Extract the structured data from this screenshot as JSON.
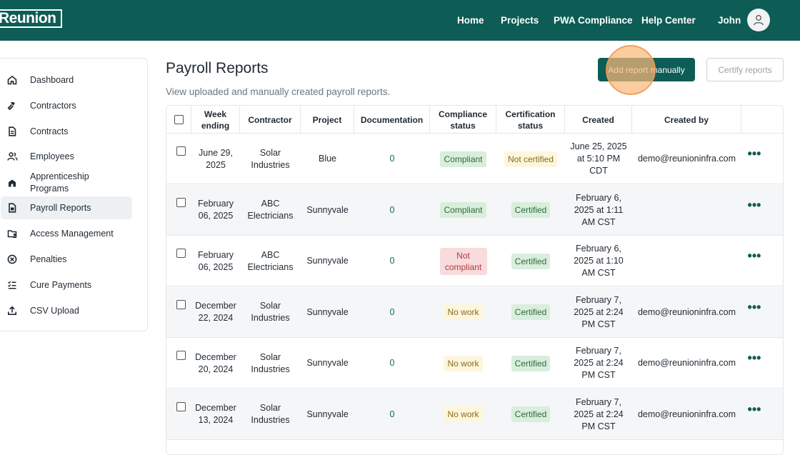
{
  "header": {
    "logo": "Reunion",
    "nav": [
      "Home",
      "Projects",
      "PWA Compliance",
      "Help Center"
    ],
    "user_name": "John"
  },
  "sidebar": {
    "items": [
      {
        "label": "Dashboard",
        "icon": "home-icon"
      },
      {
        "label": "Contractors",
        "icon": "hammer-icon"
      },
      {
        "label": "Contracts",
        "icon": "document-icon"
      },
      {
        "label": "Employees",
        "icon": "users-icon"
      },
      {
        "label": "Apprenticeship Programs",
        "icon": "building-icon"
      },
      {
        "label": "Payroll Reports",
        "icon": "report-icon",
        "active": true
      },
      {
        "label": "Access Management",
        "icon": "folder-user-icon"
      },
      {
        "label": "Penalties",
        "icon": "x-circle-icon"
      },
      {
        "label": "Cure Payments",
        "icon": "checklist-icon"
      },
      {
        "label": "CSV Upload",
        "icon": "upload-icon"
      }
    ]
  },
  "main": {
    "title": "Payroll Reports",
    "subtitle": "View uploaded and manually created payroll reports.",
    "add_button": "Add report manually",
    "certify_button": "Certify reports"
  },
  "table": {
    "columns": [
      "Week ending",
      "Contractor",
      "Project",
      "Documentation",
      "Compliance status",
      "Certification status",
      "Created",
      "Created by"
    ],
    "rows": [
      {
        "week": "June 29, 2025",
        "contractor": "Solar Industries",
        "project": "Blue",
        "docs": "0",
        "compliance": "Compliant",
        "certification": "Not certified",
        "created": "June 25, 2025 at 5:10 PM CDT",
        "created_by": "demo@reunioninfra.com"
      },
      {
        "week": "February 06, 2025",
        "contractor": "ABC Electricians",
        "project": "Sunnyvale",
        "docs": "0",
        "compliance": "Compliant",
        "certification": "Certified",
        "created": "February 6, 2025 at 1:11 AM CST",
        "created_by": ""
      },
      {
        "week": "February 06, 2025",
        "contractor": "ABC Electricians",
        "project": "Sunnyvale",
        "docs": "0",
        "compliance": "Not compliant",
        "certification": "Certified",
        "created": "February 6, 2025 at 1:10 AM CST",
        "created_by": ""
      },
      {
        "week": "December 22, 2024",
        "contractor": "Solar Industries",
        "project": "Sunnyvale",
        "docs": "0",
        "compliance": "No work",
        "certification": "Certified",
        "created": "February 7, 2025 at 2:24 PM CST",
        "created_by": "demo@reunioninfra.com"
      },
      {
        "week": "December 20, 2024",
        "contractor": "Solar Industries",
        "project": "Sunnyvale",
        "docs": "0",
        "compliance": "No work",
        "certification": "Certified",
        "created": "February 7, 2025 at 2:24 PM CST",
        "created_by": "demo@reunioninfra.com"
      },
      {
        "week": "December 13, 2024",
        "contractor": "Solar Industries",
        "project": "Sunnyvale",
        "docs": "0",
        "compliance": "No work",
        "certification": "Certified",
        "created": "February 7, 2025 at 2:24 PM CST",
        "created_by": "demo@reunioninfra.com"
      }
    ]
  },
  "colors": {
    "brand": "#0d5c55",
    "compliant": "#d9eedd",
    "not_compliant": "#f8dbdc",
    "no_work": "#fdf6dd"
  }
}
